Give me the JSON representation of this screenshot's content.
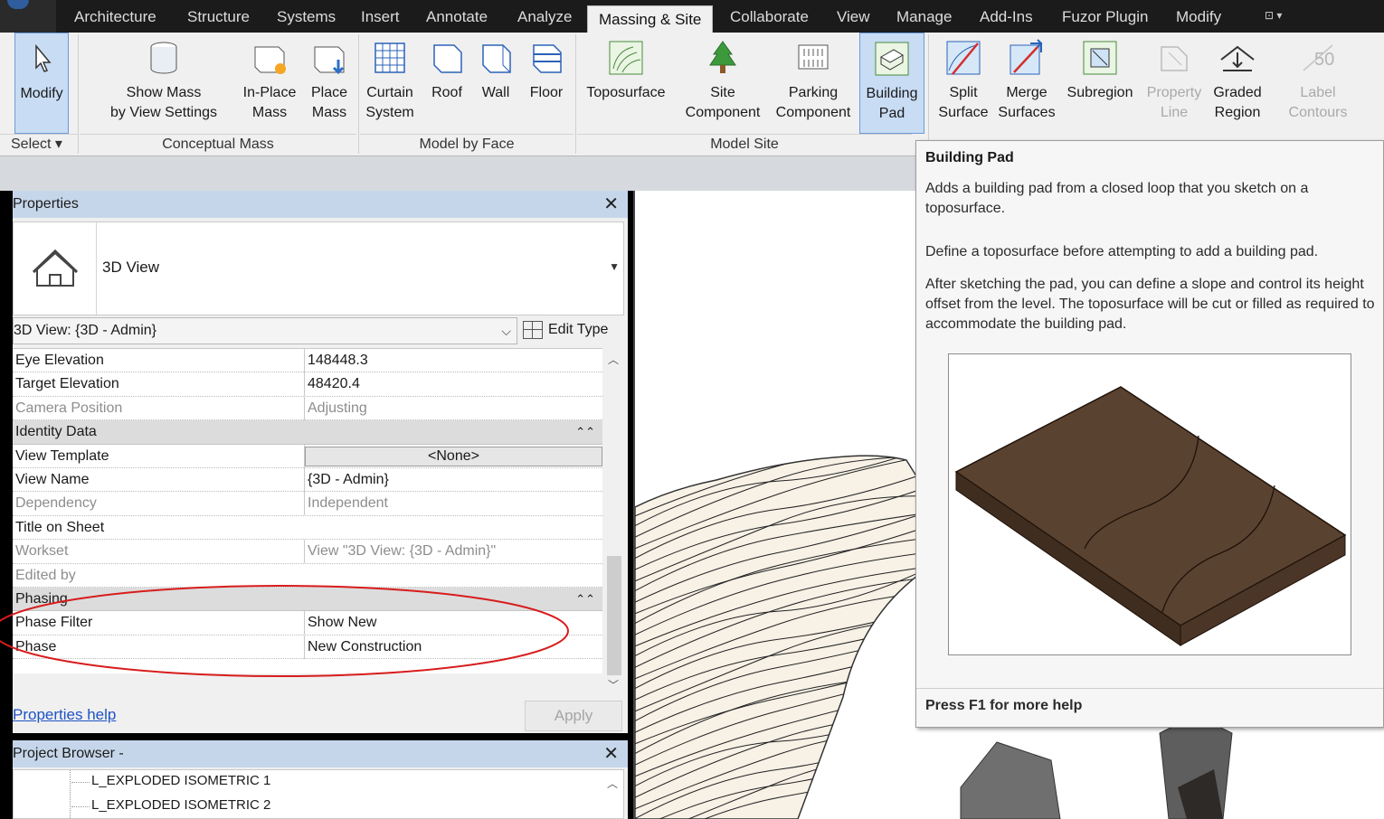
{
  "ribbon": {
    "tabs": [
      {
        "label": "Architecture"
      },
      {
        "label": "Structure"
      },
      {
        "label": "Systems"
      },
      {
        "label": "Insert"
      },
      {
        "label": "Annotate"
      },
      {
        "label": "Analyze"
      },
      {
        "label": "Massing & Site",
        "active": true
      },
      {
        "label": "Collaborate"
      },
      {
        "label": "View"
      },
      {
        "label": "Manage"
      },
      {
        "label": "Add-Ins"
      },
      {
        "label": "Fuzor Plugin"
      },
      {
        "label": "Modify"
      }
    ],
    "qat_glyph": "⊡ ▾",
    "buttons": {
      "modify": "Modify",
      "show_mass_1": "Show Mass",
      "show_mass_2": "by View Settings",
      "inplace_1": "In-Place",
      "inplace_2": "Mass",
      "place_1": "Place",
      "place_2": "Mass",
      "curtain_1": "Curtain",
      "curtain_2": "System",
      "roof": "Roof",
      "wall": "Wall",
      "floor": "Floor",
      "toposurface": "Toposurface",
      "site_1": "Site",
      "site_2": "Component",
      "parking_1": "Parking",
      "parking_2": "Component",
      "pad_1": "Building",
      "pad_2": "Pad",
      "split_1": "Split",
      "split_2": "Surface",
      "merge_1": "Merge",
      "merge_2": "Surfaces",
      "subregion": "Subregion",
      "propline_1": "Property",
      "propline_2": "Line",
      "graded_1": "Graded",
      "graded_2": "Region",
      "label_1": "Label",
      "label_2": "Contours",
      "label_icon_text": "50"
    },
    "panels": {
      "select": "Select ▾",
      "conceptual_mass": "Conceptual Mass",
      "model_by_face": "Model by Face",
      "model_site": "Model Site"
    }
  },
  "properties": {
    "title": "Properties",
    "close": "✕",
    "type_name": "3D View",
    "instance_selector": "3D View: {3D - Admin}",
    "edit_type": "Edit Type",
    "rows": [
      {
        "key": "Eye Elevation",
        "value": "148448.3"
      },
      {
        "key": "Target Elevation",
        "value": "48420.4"
      },
      {
        "key": "Camera Position",
        "value": "Adjusting",
        "readonly": true
      },
      {
        "key": "Identity Data",
        "group": true
      },
      {
        "key": "View Template",
        "value": "<None>",
        "button": true
      },
      {
        "key": "View Name",
        "value": "{3D - Admin}"
      },
      {
        "key": "Dependency",
        "value": "Independent",
        "readonly": true
      },
      {
        "key": "Title on Sheet",
        "value": ""
      },
      {
        "key": "Workset",
        "value": "View \"3D View: {3D - Admin}\"",
        "readonly": true
      },
      {
        "key": "Edited by",
        "value": "",
        "readonly": true
      },
      {
        "key": "Phasing",
        "group": true
      },
      {
        "key": "Phase Filter",
        "value": "Show New"
      },
      {
        "key": "Phase",
        "value": "New Construction"
      }
    ],
    "help_link": "Properties help",
    "apply": "Apply"
  },
  "project_browser": {
    "title": "Project Browser -",
    "close": "✕",
    "items": [
      "L_EXPLODED ISOMETRIC 1",
      "L_EXPLODED ISOMETRIC 2"
    ]
  },
  "tooltip": {
    "title": "Building Pad",
    "para1": "Adds a building pad from a closed loop that you sketch on a toposurface.",
    "para2": "Define a toposurface before attempting to add a building pad.",
    "para3": "After sketching the pad, you can define a slope and control its height offset from the level. The toposurface will be cut or filled as required to accommodate the building pad.",
    "help": "Press F1 for more help"
  },
  "colors": {
    "ribbon_bg": "#f0f0f0",
    "active_tab": "#f0f0f0",
    "selected_button": "#c8dcf4",
    "pane_header": "#c6d6ea",
    "annotation_red": "#d81c1c",
    "pad_brown": "#5a4231"
  }
}
